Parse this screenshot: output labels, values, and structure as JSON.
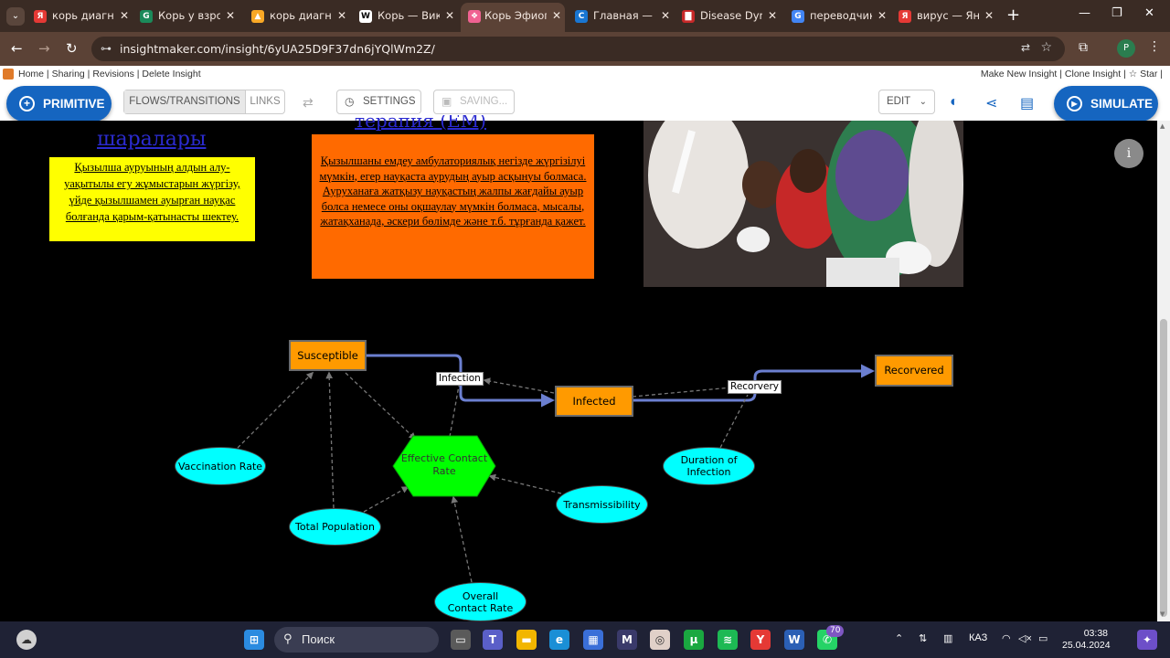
{
  "browser": {
    "tabs": [
      {
        "label": "корь диагно",
        "favicon": "Я",
        "color": "#e53935"
      },
      {
        "label": "Корь у взрос",
        "favicon": "G",
        "color": "#1b8a5a"
      },
      {
        "label": "корь диагно",
        "favicon": "▲",
        "color": "#f9a825"
      },
      {
        "label": "Корь — Вики",
        "favicon": "W",
        "color": "#ffffff"
      },
      {
        "label": "Корь Эфиоп",
        "favicon": "❖",
        "color": "#f06292",
        "active": true
      },
      {
        "label": "Главная — С",
        "favicon": "C",
        "color": "#1976d2"
      },
      {
        "label": "Disease Dyn",
        "favicon": "▇",
        "color": "#c62828"
      },
      {
        "label": "переводчик",
        "favicon": "G",
        "color": "#4285f4"
      },
      {
        "label": "вирус — Янд",
        "favicon": "Я",
        "color": "#e53935"
      }
    ],
    "url": "insightmaker.com/insight/6yUA25D9F37dn6jYQlWm2Z/"
  },
  "app": {
    "links_left": "Home | Sharing | Revisions | Delete Insight",
    "links_right": "Make New Insight | Clone Insight | ☆ Star |",
    "toolbar": {
      "primitive": "PRIMITIVE",
      "flows_transitions": "FLOWS/TRANSITIONS",
      "links": "LINKS",
      "settings": "SETTINGS",
      "saving": "SAVING...",
      "edit": "EDIT",
      "simulate": "SIMULATE"
    }
  },
  "canvas": {
    "heading_left": "шаралары",
    "heading_mid": "терапия (ЕМ)",
    "note_yellow": "Қызылша ауруының алдын алу-уақытылы егу жұмыстарын жүргізу, үйде қызылшамен ауырған науқас болғанда қарым-қатынасты шектеу.",
    "note_orange": "Қызылшаны емдеу амбулаториялық негізде жүргізілуі мүмкін, егер науқаста аурудың ауыр асқынуы болмаса. Ауруханаға жатқызу науқастың жалпы жағдайы ауыр болса немесе оны оқшаулау мүмкін болмаса, мысалы, жатақханада, әскери бөлімде және т.б. тұрғанда қажет.",
    "stocks": {
      "susceptible": "Susceptible",
      "infected": "Infected",
      "recovered": "Recorvered"
    },
    "flows": {
      "infection": "Infection",
      "recovery": "Recorvery"
    },
    "variables": {
      "vaccination_rate": "Vaccination Rate",
      "total_population": "Total Population",
      "effective_contact_rate": "Effective Contact Rate",
      "transmissibility": "Transmissibility",
      "duration_of_infection": "Duration of Infection",
      "overall_contact_rate": "Overall Contact Rate"
    },
    "colors": {
      "stock": "#ff9a00",
      "variable": "#00ffff",
      "converter": "#00ff00",
      "flow": "#6b7fd0",
      "yellow_note": "#ffff00",
      "orange_note": "#ff6a00"
    }
  },
  "taskbar": {
    "search_placeholder": "Поиск",
    "language": "КАЗ",
    "time": "03:38",
    "date": "25.04.2024",
    "whatsapp_badge": "70"
  }
}
